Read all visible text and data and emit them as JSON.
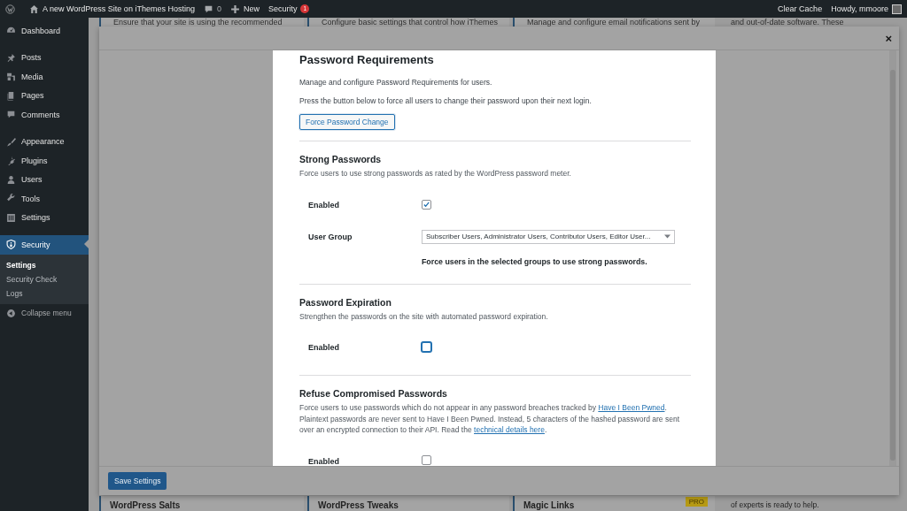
{
  "admin_bar": {
    "site": "A new WordPress Site on iThemes Hosting",
    "comments": "0",
    "new": "New",
    "security": "Security",
    "security_badge": "1",
    "clear_cache": "Clear Cache",
    "howdy": "Howdy, mmoore"
  },
  "sidebar": {
    "groups": [
      {
        "items": [
          {
            "label": "Dashboard",
            "selected": false
          }
        ]
      },
      {
        "items": [
          {
            "label": "Posts",
            "selected": false
          },
          {
            "label": "Media",
            "selected": false
          },
          {
            "label": "Pages",
            "selected": false
          },
          {
            "label": "Comments",
            "selected": false
          }
        ]
      },
      {
        "items": [
          {
            "label": "Appearance",
            "selected": false
          },
          {
            "label": "Plugins",
            "selected": false
          },
          {
            "label": "Users",
            "selected": false
          },
          {
            "label": "Tools",
            "selected": false
          },
          {
            "label": "Settings",
            "selected": false
          }
        ]
      },
      {
        "items": [
          {
            "label": "Security",
            "selected": true,
            "children": [
              {
                "label": "Settings",
                "selected": true
              },
              {
                "label": "Security Check",
                "selected": false
              },
              {
                "label": "Logs",
                "selected": false
              }
            ]
          }
        ]
      }
    ],
    "collapse": "Collapse menu"
  },
  "background": {
    "top_cards": [
      "Ensure that your site is using the recommended",
      "Configure basic settings that control how iThemes",
      "Manage and configure email notifications sent by",
      "and out-of-date software. These"
    ],
    "bottom_cards": [
      {
        "title": "WordPress Salts"
      },
      {
        "title": "WordPress Tweaks"
      },
      {
        "title": "Magic Links",
        "badge": "PRO"
      },
      {
        "title": "of experts is ready to help."
      }
    ]
  },
  "modal": {
    "close": "×",
    "panel": {
      "title": "Password Requirements",
      "description": "Manage and configure Password Requirements for users.",
      "note": "Press the button below to force all users to change their password upon their next login.",
      "button": "Force Password Change"
    },
    "sections": [
      {
        "title": "Strong Passwords",
        "description": [
          {
            "kind": "text",
            "text": "Force users to use strong passwords as rated by the WordPress password meter."
          }
        ],
        "settings": [
          {
            "kind": "checkbox",
            "label": "Enabled",
            "checked": true,
            "focused": false
          },
          {
            "kind": "select",
            "label": "User Group",
            "value": "Subscriber Users, Administrator Users, Contributor Users, Editor User...",
            "help": "Force users in the selected groups to use strong passwords."
          }
        ]
      },
      {
        "title": "Password Expiration",
        "description": [
          {
            "kind": "text",
            "text": "Strengthen the passwords on the site with automated password expiration."
          }
        ],
        "settings": [
          {
            "kind": "checkbox",
            "label": "Enabled",
            "checked": false,
            "focused": true
          }
        ]
      },
      {
        "title": "Refuse Compromised Passwords",
        "description": [
          {
            "kind": "text",
            "text": "Force users to use passwords which do not appear in any password breaches tracked by "
          },
          {
            "kind": "link",
            "text": "Have I Been Pwned"
          },
          {
            "kind": "text",
            "text": ". Plaintext passwords are never sent to Have I Been Pwned. Instead, 5 characters of the hashed password are sent over an encrypted connection to their API. Read the "
          },
          {
            "kind": "link",
            "text": "technical details here"
          },
          {
            "kind": "text",
            "text": "."
          }
        ],
        "settings": [
          {
            "kind": "checkbox",
            "label": "Enabled",
            "checked": false,
            "focused": false
          }
        ]
      }
    ],
    "footer_button": "Save Settings"
  }
}
